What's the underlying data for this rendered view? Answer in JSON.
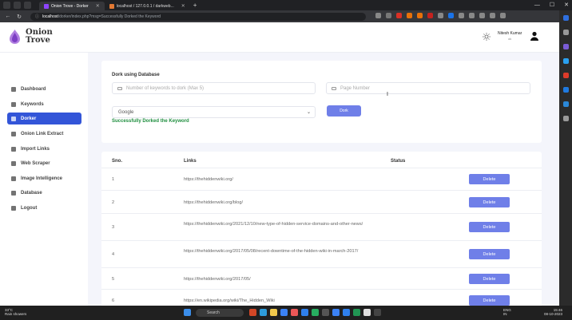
{
  "browser": {
    "tabs": [
      {
        "label": "Onion Trove - Dorker",
        "active": true
      },
      {
        "label": "localhost / 127.0.0.1 / darkweb...",
        "active": false
      }
    ],
    "url_host": "localhost",
    "url_path": "/dorker/index.php?msg=Successfully Dorked the Keyword"
  },
  "app": {
    "logo_line1": "Onion",
    "logo_line2": "Trove",
    "user_name": "Nitesh Kumar",
    "user_role": "ok"
  },
  "sidebar": {
    "items": [
      {
        "label": "Dashboard",
        "icon": "home-icon"
      },
      {
        "label": "Keywords",
        "icon": "keyword-icon"
      },
      {
        "label": "Dorker",
        "icon": "dorker-icon"
      },
      {
        "label": "Onion Link Extract",
        "icon": "gear-icon"
      },
      {
        "label": "Import Links",
        "icon": "upload-icon"
      },
      {
        "label": "Web Scraper",
        "icon": "spider-icon"
      },
      {
        "label": "Image Intelligence",
        "icon": "image-icon"
      },
      {
        "label": "Database",
        "icon": "database-icon"
      },
      {
        "label": "Logout",
        "icon": "logout-icon"
      }
    ],
    "active_index": 2
  },
  "form": {
    "title": "Dork using Database",
    "keywords_placeholder": "Number of keywords to dork (Max 5)",
    "page_placeholder": "Page Number",
    "engine_value": "Google",
    "dork_button": "Dork",
    "success_message": "Successfully Dorked the Keyword"
  },
  "table": {
    "headers": {
      "sno": "Sno.",
      "links": "Links",
      "status": "Status"
    },
    "delete_label": "Delete",
    "rows": [
      {
        "sno": "1",
        "link": "https://thehiddenwiki.org/"
      },
      {
        "sno": "2",
        "link": "https://thehiddenwiki.org/blog/"
      },
      {
        "sno": "3",
        "link": "https://thehiddenwiki.org/2021/12/10/new-type-of-hidden-service-domains-and-other-news/"
      },
      {
        "sno": "4",
        "link": "https://thehiddenwiki.org/2017/05/08/recent-downtime-of-the-hidden-wiki-in-march-2017/"
      },
      {
        "sno": "5",
        "link": "https://thehiddenwiki.org/2017/05/"
      },
      {
        "sno": "6",
        "link": "https://en.wikipedia.org/wiki/The_Hidden_Wiki"
      }
    ]
  },
  "taskbar": {
    "weather_temp": "33°C",
    "weather_desc": "Rain showers",
    "search_label": "Search",
    "lang_line1": "ENG",
    "lang_line2": "IN",
    "time": "15:46",
    "date": "08-10-2023"
  },
  "colors": {
    "accent": "#3355d8",
    "button": "#6f7fe8",
    "success": "#1e8e3e"
  }
}
